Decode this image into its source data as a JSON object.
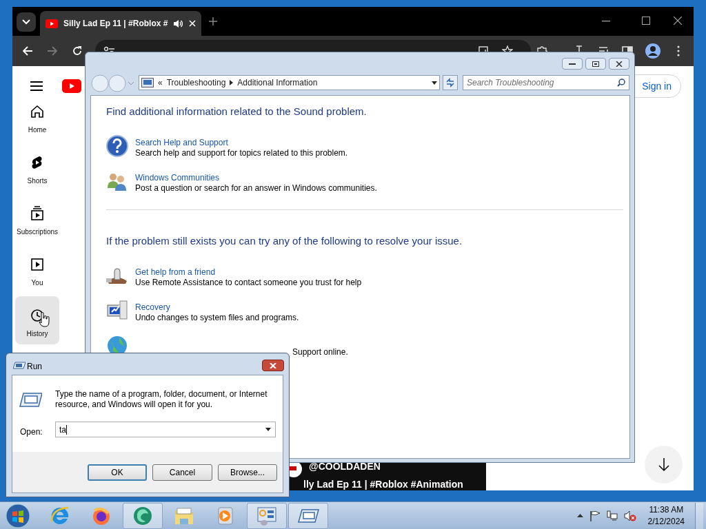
{
  "browser": {
    "tab_title": "Silly Lad Ep 11 | #Roblox #"
  },
  "youtube": {
    "sidebar": [
      {
        "kind": "home",
        "label": "Home",
        "hovered": false
      },
      {
        "kind": "shorts",
        "label": "Shorts",
        "hovered": false
      },
      {
        "kind": "subscriptions",
        "label": "Subscriptions",
        "hovered": false
      },
      {
        "kind": "you",
        "label": "You",
        "hovered": false
      },
      {
        "kind": "history",
        "label": "History",
        "hovered": true
      }
    ],
    "sign_in": "Sign in",
    "video": {
      "channel": "@COOLDADEN",
      "title": "lly Lad Ep 11 | #Roblox #Animation"
    }
  },
  "explorer": {
    "overflow": "«",
    "breadcrumb": [
      "Troubleshooting",
      "Additional Information"
    ],
    "search_placeholder": "Search Troubleshooting",
    "sections": [
      {
        "heading": "Find additional information related to the Sound problem.",
        "items": [
          {
            "kind": "help",
            "link": "Search Help and Support",
            "description": "Search help and support for topics related to this problem."
          },
          {
            "kind": "community",
            "link": "Windows Communities",
            "description": "Post a question or search for an answer in Windows communities."
          }
        ]
      },
      {
        "heading": "If the problem still exists you can try any of the following to resolve your issue.",
        "items": [
          {
            "kind": "friend",
            "link": "Get help from a friend",
            "description": "Use Remote Assistance to contact someone you trust for help"
          },
          {
            "kind": "recovery",
            "link": "Recovery",
            "description": "Undo changes to system files and programs."
          },
          {
            "kind": "online",
            "description": "Support online."
          }
        ]
      }
    ]
  },
  "run_dialog": {
    "title": "Run",
    "message": "Type the name of a program, folder, document, or Internet resource, and Windows will open it for you.",
    "open_label": "Open:",
    "value": "ta",
    "buttons": [
      {
        "label": "OK",
        "default": true
      },
      {
        "label": "Cancel",
        "default": false
      },
      {
        "label": "Browse...",
        "default": false
      }
    ]
  },
  "taskbar": {
    "apps": [
      {
        "kind": "ie",
        "active": false
      },
      {
        "kind": "firefox",
        "active": false
      },
      {
        "kind": "sphere",
        "active": true
      },
      {
        "kind": "folder",
        "active": false
      },
      {
        "kind": "media",
        "active": false
      },
      {
        "kind": "control-panel",
        "active": true
      },
      {
        "kind": "run",
        "active": true
      }
    ],
    "time": "11:38 AM",
    "date": "2/12/2024"
  }
}
